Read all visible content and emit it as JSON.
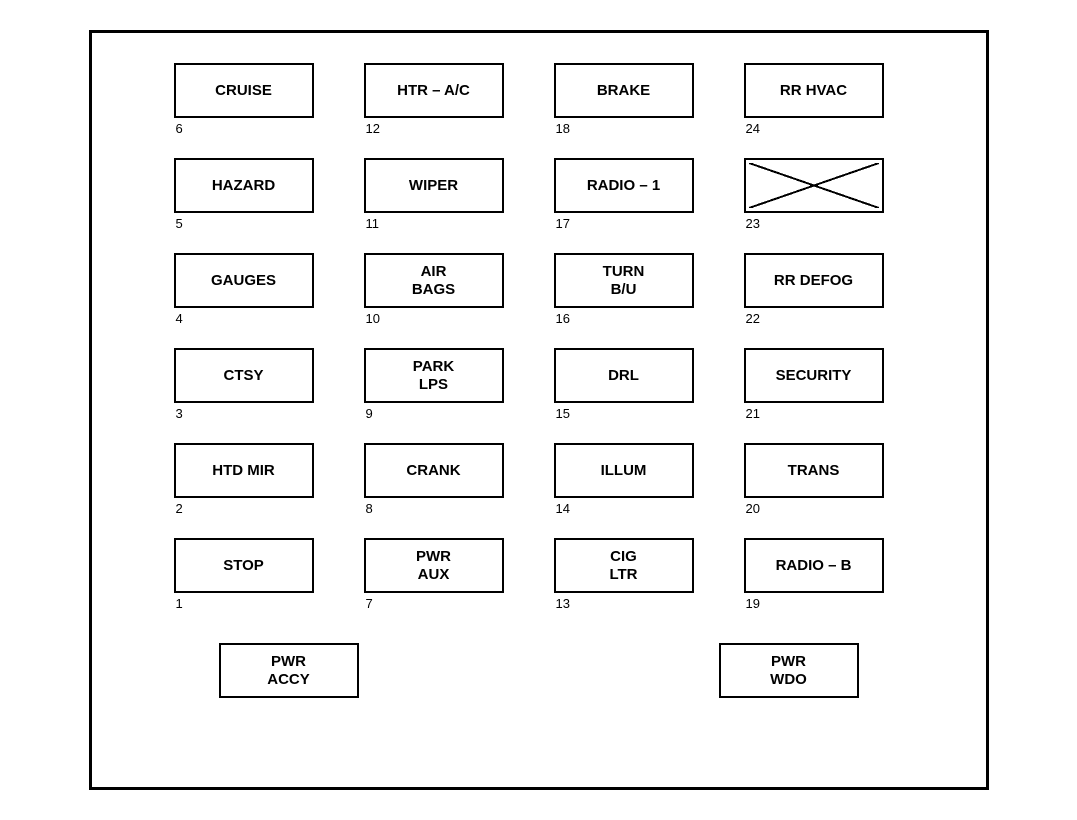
{
  "grid": {
    "rows": [
      [
        {
          "label": "CRUISE",
          "num": "6",
          "type": "box"
        },
        {
          "label": "HTR – A/C",
          "num": "12",
          "type": "box"
        },
        {
          "label": "BRAKE",
          "num": "18",
          "type": "box"
        },
        {
          "label": "RR HVAC",
          "num": "24",
          "type": "box"
        }
      ],
      [
        {
          "label": "HAZARD",
          "num": "5",
          "type": "box"
        },
        {
          "label": "WIPER",
          "num": "11",
          "type": "box"
        },
        {
          "label": "RADIO – 1",
          "num": "17",
          "type": "box"
        },
        {
          "label": "",
          "num": "23",
          "type": "x"
        }
      ],
      [
        {
          "label": "GAUGES",
          "num": "4",
          "type": "box"
        },
        {
          "label": "AIR\nBAGS",
          "num": "10",
          "type": "box"
        },
        {
          "label": "TURN\nB/U",
          "num": "16",
          "type": "box"
        },
        {
          "label": "RR DEFOG",
          "num": "22",
          "type": "box"
        }
      ],
      [
        {
          "label": "CTSY",
          "num": "3",
          "type": "box"
        },
        {
          "label": "PARK\nLPS",
          "num": "9",
          "type": "box"
        },
        {
          "label": "DRL",
          "num": "15",
          "type": "box"
        },
        {
          "label": "SECURITY",
          "num": "21",
          "type": "box"
        }
      ],
      [
        {
          "label": "HTD MIR",
          "num": "2",
          "type": "box"
        },
        {
          "label": "CRANK",
          "num": "8",
          "type": "box"
        },
        {
          "label": "ILLUM",
          "num": "14",
          "type": "box"
        },
        {
          "label": "TRANS",
          "num": "20",
          "type": "box"
        }
      ],
      [
        {
          "label": "STOP",
          "num": "1",
          "type": "box"
        },
        {
          "label": "PWR\nAUX",
          "num": "7",
          "type": "box"
        },
        {
          "label": "CIG\nLTR",
          "num": "13",
          "type": "box"
        },
        {
          "label": "RADIO – B",
          "num": "19",
          "type": "box"
        }
      ]
    ]
  },
  "bottom": {
    "left": {
      "label": "PWR\nACCY",
      "type": "box"
    },
    "right": {
      "label": "PWR\nWDO",
      "type": "box"
    }
  }
}
